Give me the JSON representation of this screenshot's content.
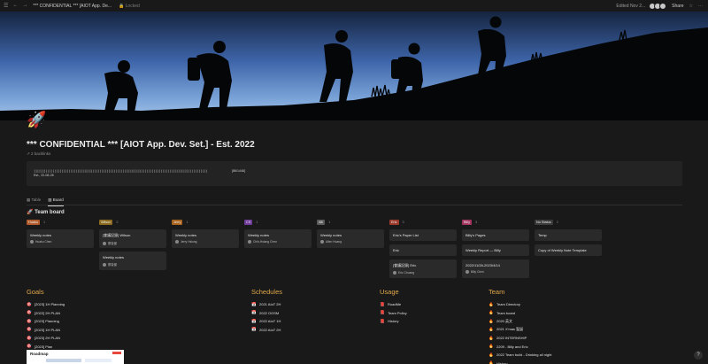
{
  "topbar": {
    "breadcrumb": "*** CONFIDENTIAL *** [AIOT App. De...",
    "locked": "Locked",
    "edited": "Edited Nov 2...",
    "share": "Share"
  },
  "page": {
    "icon": "rocket-icon",
    "title": "*** CONFIDENTIAL *** [AIOT App. Dev. Set.] - Est. 2022",
    "backlinks": "2 backlinks"
  },
  "callout": {
    "progress_bar": "||||||||||||||||||||||||||||||||||||||||||||||||||||||||||||||||||||||||||||||||||||||||||||||||||||",
    "progress_count": "[86/1446]",
    "date": "Est., 22-08-28"
  },
  "views": {
    "tabs": [
      "Table",
      "Board"
    ],
    "active": "Board"
  },
  "board": {
    "title": "Team board",
    "columns": [
      {
        "name": "Huaku",
        "color": "#b15b2c",
        "count": "1",
        "cards": [
          {
            "title": "Weekly notes",
            "person": "Huaku Chen"
          }
        ]
      },
      {
        "name": "Wilson",
        "color": "#8a6a1e",
        "count": "2",
        "cards": [
          {
            "title": "[會議記錄] Wilson",
            "person": "蔡竣傑"
          },
          {
            "title": "Weekly notes",
            "person": "蔡竣傑"
          }
        ]
      },
      {
        "name": "Jerry",
        "color": "#a8641f",
        "count": "1",
        "cards": [
          {
            "title": "Weekly notes",
            "person": "Jerry Hsiung"
          }
        ]
      },
      {
        "name": "CS",
        "color": "#6f3c9a",
        "count": "1",
        "cards": [
          {
            "title": "Weekly notes",
            "person": "Chih-Hsiang Chen"
          }
        ]
      },
      {
        "name": "Alli",
        "color": "#5a5a5a",
        "count": "1",
        "cards": [
          {
            "title": "Weekly notes",
            "person": "Allen Huang"
          }
        ]
      },
      {
        "name": "Eric",
        "color": "#9b3a2a",
        "count": "3",
        "cards": [
          {
            "title": "Eric's Paper List",
            "person": ""
          },
          {
            "title": "Eric",
            "person": ""
          },
          {
            "title": "[會議記錄] Eric",
            "person": "Eric Chuang"
          }
        ]
      },
      {
        "name": "Billy",
        "color": "#a3345f",
        "count": "3",
        "cards": [
          {
            "title": "Billy's Pages",
            "person": ""
          },
          {
            "title": "Weekly Report — Billy",
            "person": ""
          },
          {
            "title": "2022/11/28-2023/4/14",
            "person": "Billy Chen"
          }
        ]
      },
      {
        "name": "No Status",
        "color": "#3a3a3a",
        "count": "2",
        "cards": [
          {
            "title": "Temp",
            "person": ""
          },
          {
            "title": "Copy of Weekly Note Template",
            "person": ""
          }
        ]
      }
    ]
  },
  "sections": {
    "goals": {
      "title": "Goals",
      "items": [
        "[2023] 1H Planning",
        "[2022] 2H PLAN",
        "[2023] Planning",
        "[2023] 1H PLAN",
        "[2023] 2H PLAN",
        "[2023] Plan"
      ]
    },
    "schedules": {
      "title": "Schedules",
      "items": [
        "2021 AIoT 2H",
        "2022 OGSM",
        "2022 AIoT 1H",
        "2022 AIoT 2H"
      ]
    },
    "usage": {
      "title": "Usage",
      "items": [
        "RoadMe",
        "Team Policy",
        "History"
      ]
    },
    "team": {
      "title": "Team",
      "items": [
        "Team Directory",
        "Team board",
        "2020 英文",
        "2021 X'mas 聖誕",
        "2022 INTERNSHIP",
        "2209 - Billy and Eric",
        "2022 Team build - Drinking all night",
        "History"
      ]
    }
  },
  "roadmap": {
    "label": "Roadmap"
  },
  "help": {
    "label": "?"
  }
}
